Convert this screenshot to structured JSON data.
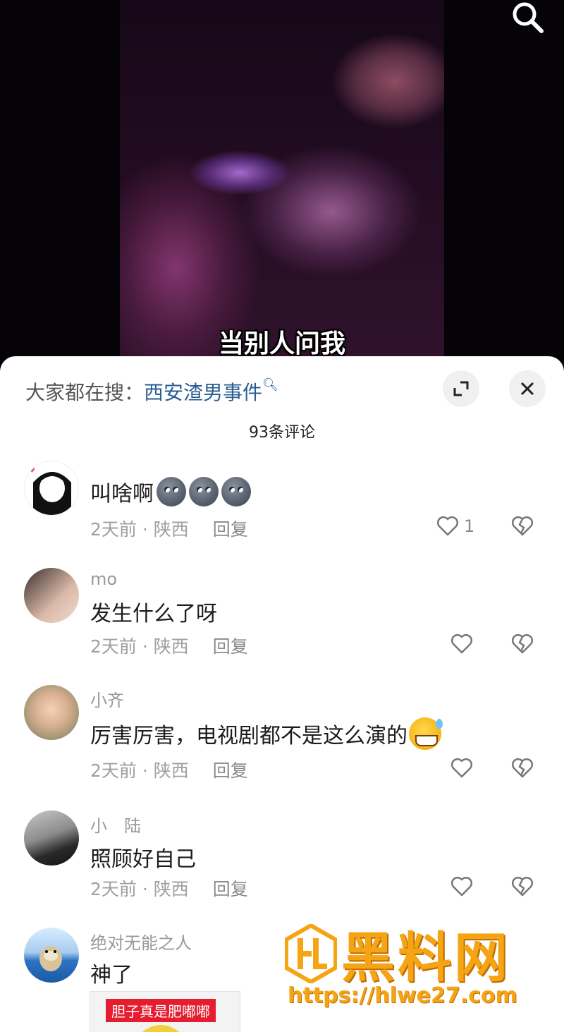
{
  "video": {
    "subtitle": "当别人问我"
  },
  "panel": {
    "hot_search_label": "大家都在搜：",
    "hot_search_term": "西安渣男事件",
    "comment_count": "93条评论"
  },
  "comments": [
    {
      "username": "",
      "text": "叫啥啊",
      "emoji": "moon-face-emoji x3",
      "time": "2天前",
      "location": "陕西",
      "reply": "回复",
      "likes": "1"
    },
    {
      "username": "mo",
      "text": "发生什么了呀",
      "time": "2天前",
      "location": "陕西",
      "reply": "回复",
      "likes": ""
    },
    {
      "username": "小齐",
      "text": "厉害厉害，电视剧都不是这么演的",
      "emoji": "grinning-sweat-emoji",
      "time": "2天前",
      "location": "陕西",
      "reply": "回复",
      "likes": ""
    },
    {
      "username": "小　陆",
      "text": "照顾好自己",
      "time": "2天前",
      "location": "陕西",
      "reply": "回复",
      "likes": ""
    },
    {
      "username": "绝对无能之人",
      "text": "神了",
      "sticker_text": "胆子真是肥嘟嘟"
    }
  ],
  "watermark": {
    "title": "黑料网",
    "url": "https://hlwe27.com"
  },
  "colors": {
    "link_blue": "#2a5e92",
    "watermark_orange": "#f5a414"
  }
}
